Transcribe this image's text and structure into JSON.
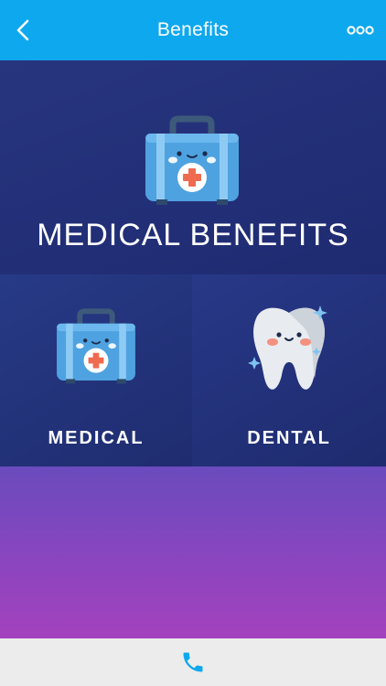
{
  "header": {
    "title": "Benefits",
    "back_icon": "chevron-left-icon",
    "more_icon": "more-dots-icon"
  },
  "hero": {
    "heading": "MEDICAL BENEFITS",
    "icon": "medical-kit-icon"
  },
  "tiles": [
    {
      "label": "MEDICAL",
      "icon": "medical-kit-icon"
    },
    {
      "label": "DENTAL",
      "icon": "tooth-icon"
    }
  ],
  "footer": {
    "icon": "phone-icon"
  },
  "colors": {
    "header_bg": "#0ea8ee",
    "hero_bg": "#222f77",
    "gradient_top": "#6a4bbd",
    "gradient_bottom": "#a442bd",
    "footer_bg": "#ececec",
    "phone_icon": "#0ea8ee"
  }
}
